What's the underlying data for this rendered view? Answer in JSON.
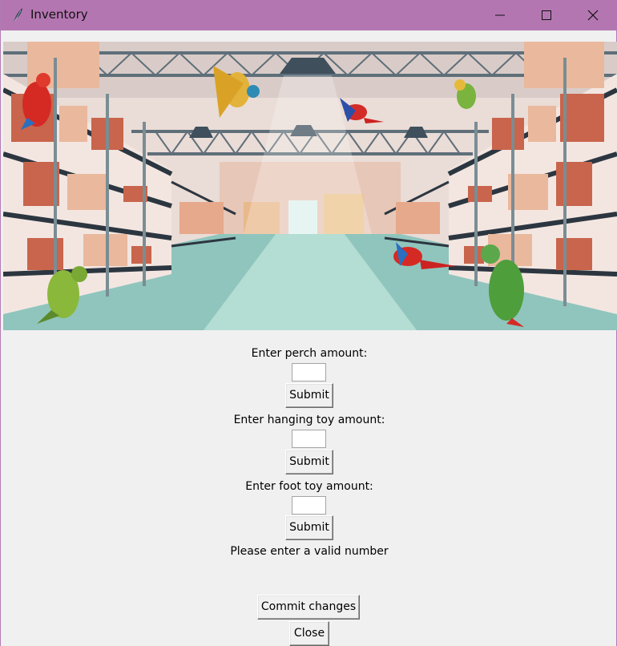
{
  "window": {
    "title": "Inventory",
    "titlebar_color": "#b476b1"
  },
  "icons": {
    "app": "feather-icon",
    "minimize": "minimize-icon",
    "maximize": "maximize-icon",
    "close": "close-icon"
  },
  "form": {
    "perch_label": "Enter perch amount:",
    "perch_value": "",
    "hanging_label": "Enter hanging toy amount:",
    "hanging_value": "",
    "foot_label": "Enter foot toy amount:",
    "foot_value": "",
    "submit_label": "Submit",
    "status_message": "Please enter a valid number",
    "commit_label": "Commit changes",
    "close_label": "Close"
  },
  "image": {
    "subject": "warehouse with shelves and parrots"
  }
}
